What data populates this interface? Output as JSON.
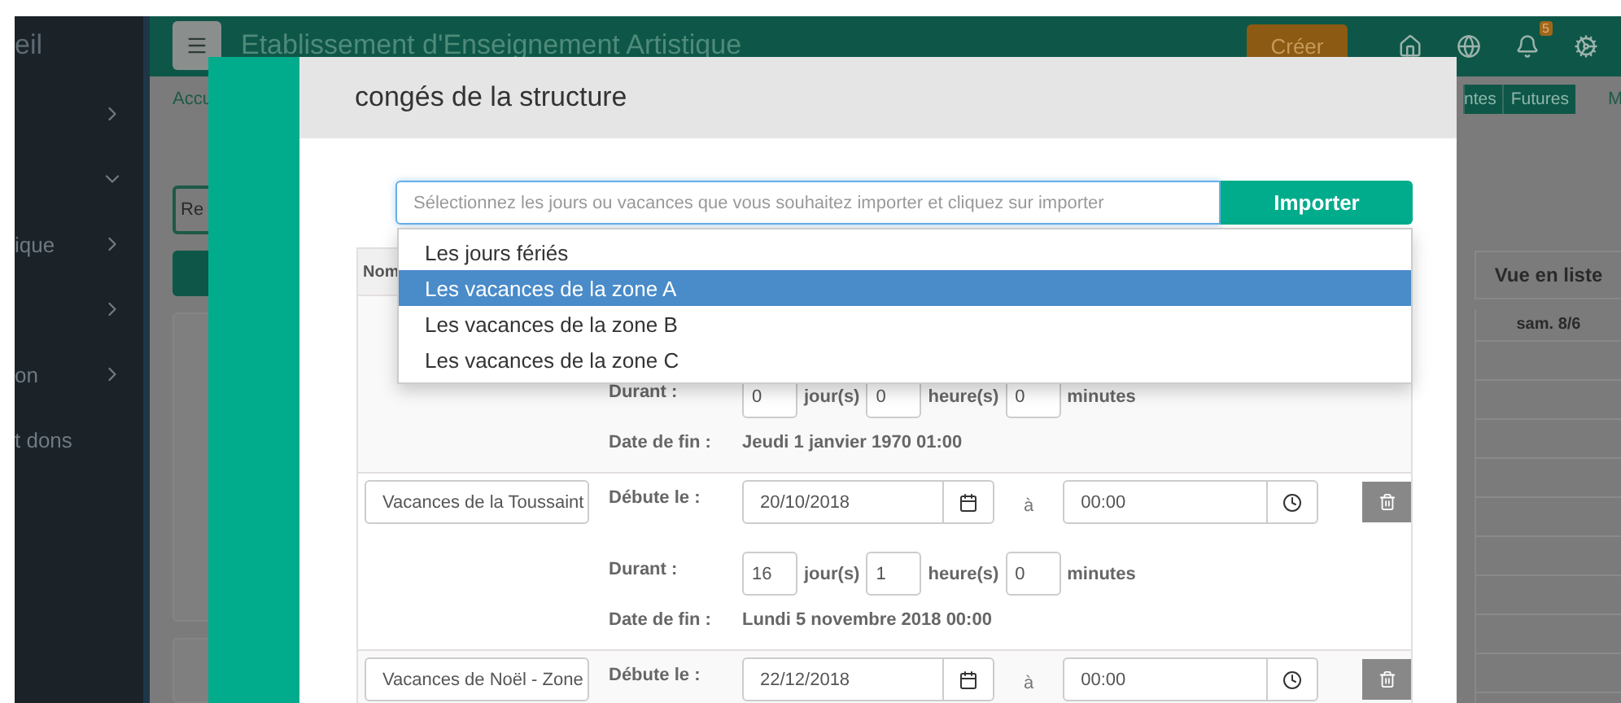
{
  "sidebar": {
    "header": "eil",
    "items": [
      {
        "expanded": false
      },
      {
        "expanded": true
      },
      {
        "label": "ique",
        "expanded": false
      },
      {
        "expanded": false
      },
      {
        "label": "on",
        "expanded": false
      },
      {
        "label": "t dons"
      }
    ]
  },
  "topbar": {
    "title": "Etablissement d'Enseignement Artistique",
    "create_button": "Créer",
    "notification_count": "5"
  },
  "page": {
    "breadcrumb": "Accu",
    "tabs": [
      "ntes",
      "Futures"
    ],
    "tab_extra": "M",
    "search_value": "Re",
    "calendar": {
      "header": "Vue en liste",
      "day": "sam. 8/6"
    }
  },
  "modal": {
    "title": "congés de la structure",
    "import": {
      "placeholder": "Sélectionnez les jours ou vacances que vous souhaitez importer et cliquez sur importer",
      "button": "Importer",
      "options": [
        {
          "label": "Les jours fériés",
          "selected": false
        },
        {
          "label": "Les vacances de la zone A",
          "selected": true
        },
        {
          "label": "Les vacances de la zone B",
          "selected": false
        },
        {
          "label": "Les vacances de la zone C",
          "selected": false
        }
      ]
    },
    "table": {
      "columns": [
        "Nom"
      ],
      "rows": [
        {
          "deletable": false,
          "duration_label": "Durant :",
          "days": "0",
          "days_unit": "jour(s)",
          "hours": "0",
          "hours_unit": "heure(s)",
          "minutes": "0",
          "minutes_unit": "minutes",
          "end_label": "Date de fin :",
          "end_date": "Jeudi 1 janvier 1970 01:00"
        },
        {
          "deletable": true,
          "name": "Vacances de la Toussaint",
          "start_label": "Débute le :",
          "start_date": "20/10/2018",
          "at": "à",
          "start_time": "00:00",
          "duration_label": "Durant :",
          "days": "16",
          "days_unit": "jour(s)",
          "hours": "1",
          "hours_unit": "heure(s)",
          "minutes": "0",
          "minutes_unit": "minutes",
          "end_label": "Date de fin :",
          "end_date": "Lundi 5 novembre 2018 00:00"
        },
        {
          "deletable": true,
          "name": "Vacances de Noël - Zone",
          "start_label": "Débute le :",
          "start_date": "22/12/2018",
          "at": "à",
          "start_time": "00:00"
        }
      ]
    }
  }
}
